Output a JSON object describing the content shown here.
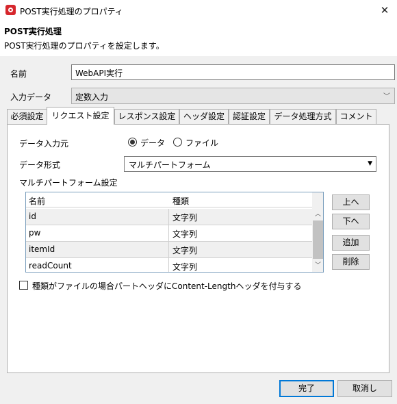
{
  "window": {
    "title": "POST実行処理のプロパティ",
    "close_glyph": "✕"
  },
  "header": {
    "title": "POST実行処理",
    "description": "POST実行処理のプロパティを設定します。"
  },
  "form": {
    "name_label": "名前",
    "name_value": "WebAPI実行",
    "input_label": "入力データ",
    "input_value": "定数入力"
  },
  "tabs": [
    {
      "label": "必須設定"
    },
    {
      "label": "リクエスト設定",
      "active": true
    },
    {
      "label": "レスポンス設定"
    },
    {
      "label": "ヘッダ設定"
    },
    {
      "label": "認証設定"
    },
    {
      "label": "データ処理方式"
    },
    {
      "label": "コメント"
    }
  ],
  "request": {
    "source_label": "データ入力元",
    "radio_data": "データ",
    "radio_file": "ファイル",
    "format_label": "データ形式",
    "format_value": "マルチパートフォーム",
    "multipart_label": "マルチパートフォーム設定",
    "table": {
      "headers": [
        "名前",
        "種類"
      ],
      "rows": [
        [
          "id",
          "文字列"
        ],
        [
          "pw",
          "文字列"
        ],
        [
          "itemId",
          "文字列"
        ],
        [
          "readCount",
          "文字列"
        ]
      ]
    },
    "buttons": {
      "up": "上へ",
      "down": "下へ",
      "add": "追加",
      "delete": "削除"
    },
    "content_length_checkbox": "種類がファイルの場合パートヘッダにContent-Lengthヘッダを付与する"
  },
  "footer": {
    "ok": "完了",
    "cancel": "取消し"
  }
}
